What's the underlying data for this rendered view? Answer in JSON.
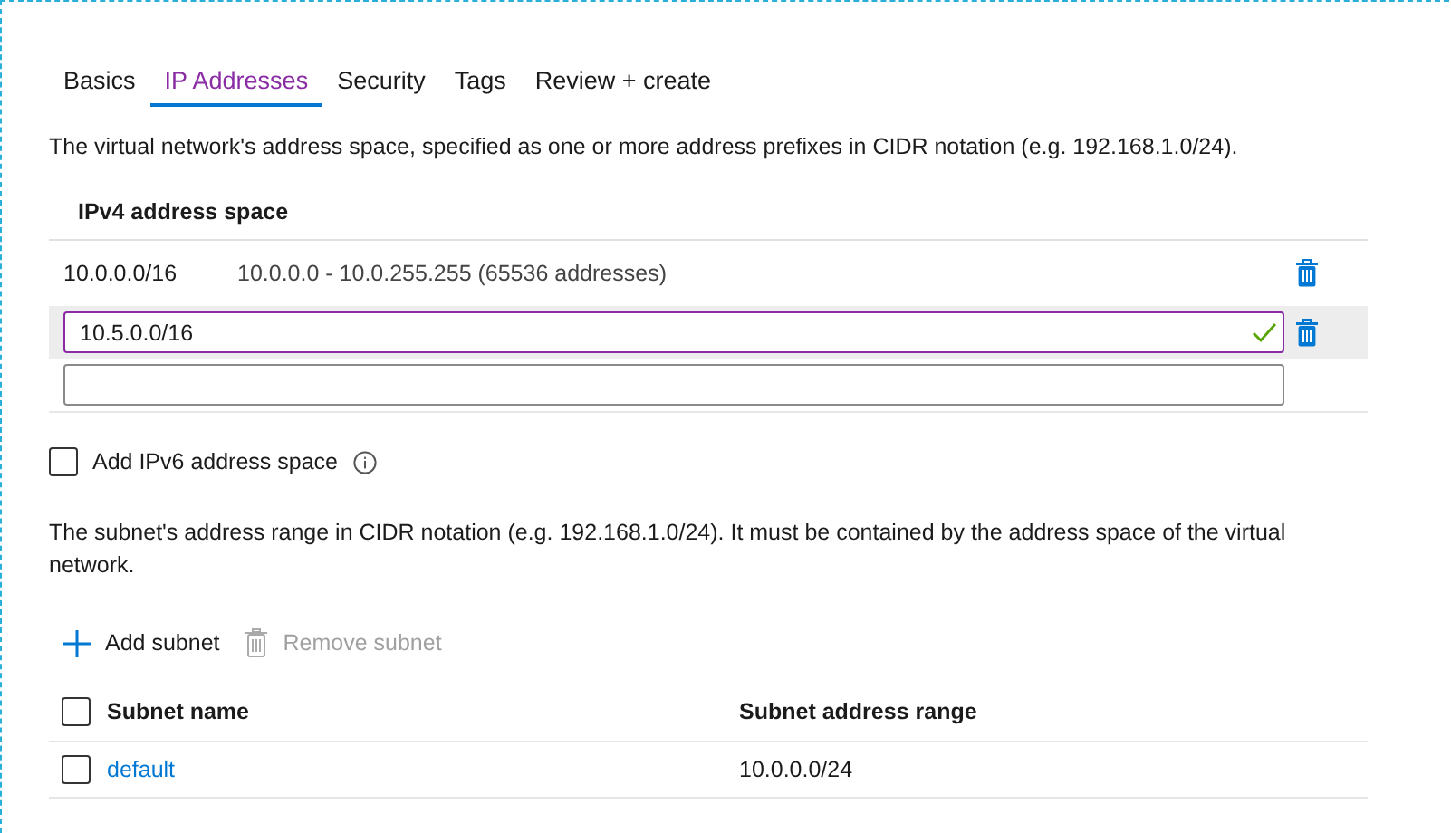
{
  "tabs": [
    {
      "label": "Basics",
      "selected": false
    },
    {
      "label": "IP Addresses",
      "selected": true
    },
    {
      "label": "Security",
      "selected": false
    },
    {
      "label": "Tags",
      "selected": false
    },
    {
      "label": "Review + create",
      "selected": false
    }
  ],
  "address_description": "The virtual network's address space, specified as one or more address prefixes in CIDR notation (e.g. 192.168.1.0/24).",
  "ipv4_heading": "IPv4 address space",
  "address_rows": [
    {
      "kind": "prefix",
      "prefix": "10.0.0.0/16",
      "range": "10.0.0.0 - 10.0.255.255 (65536 addresses)",
      "deletable": true,
      "selected": false
    },
    {
      "kind": "input",
      "value": "10.5.0.0/16",
      "valid": true,
      "deletable": true,
      "selected": true
    },
    {
      "kind": "input",
      "valid": false,
      "deletable": false,
      "selected": false
    }
  ],
  "ipv6_option": {
    "label": "Add IPv6 address space",
    "checked": false
  },
  "subnet_description": "The subnet's address range in CIDR notation (e.g. 192.168.1.0/24). It must be contained by the address space of the virtual network.",
  "toolbar": [
    {
      "kind": "add",
      "label": "Add subnet",
      "disabled": false
    },
    {
      "kind": "remove",
      "label": "Remove subnet",
      "disabled": true
    }
  ],
  "subnet_table": {
    "select_all_checked": false,
    "columns": [
      "Subnet name",
      "Subnet address range"
    ],
    "rows": [
      {
        "name": "default",
        "range": "10.0.0.0/24",
        "checked": false
      }
    ]
  }
}
